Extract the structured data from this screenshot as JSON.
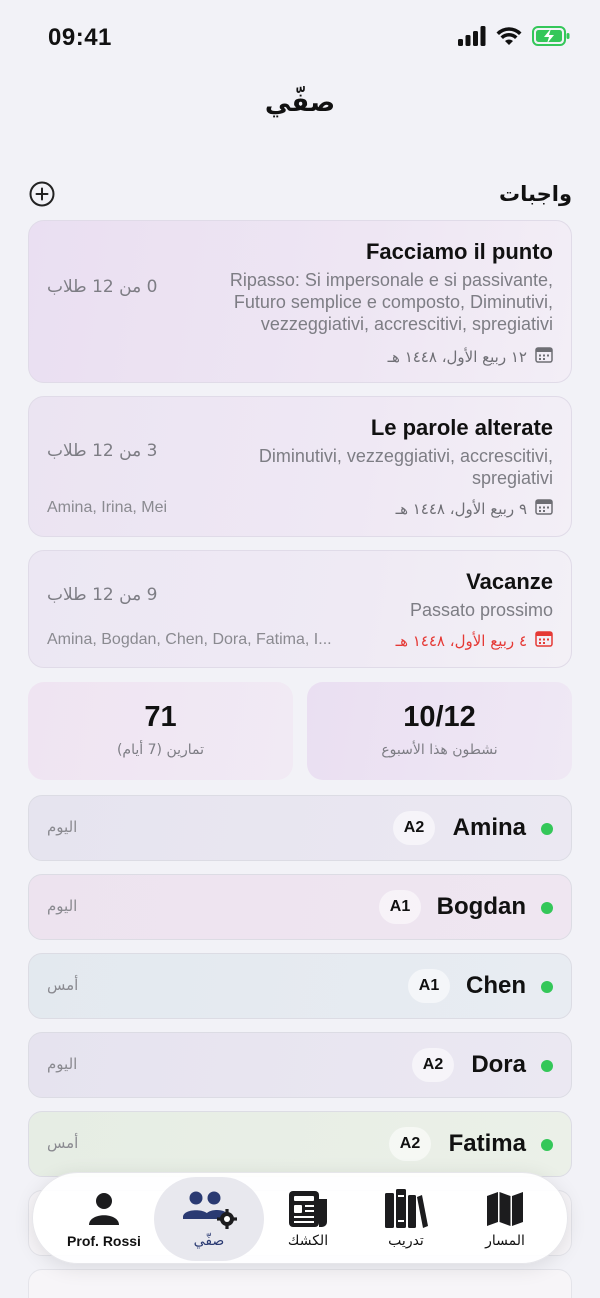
{
  "status": {
    "time": "09:41"
  },
  "page": {
    "title": "صفّي"
  },
  "assignments": {
    "title": "واجبات",
    "items": [
      {
        "title": "Facciamo il punto",
        "subtitle": "Ripasso: Si impersonale e si passivante, Futuro semplice e composto, Diminutivi, vezzeggiativi, accrescitivi, spregiativi",
        "date": "١٢ ربيع الأول، ١٤٤٨ هـ",
        "count": "0 من 12 طلاب",
        "names": "",
        "overdue": false
      },
      {
        "title": "Le parole alterate",
        "subtitle": "Diminutivi, vezzeggiativi, accrescitivi, spregiativi",
        "date": "٩ ربيع الأول، ١٤٤٨ هـ",
        "count": "3 من 12 طلاب",
        "names": "Amina, Irina, Mei",
        "overdue": false
      },
      {
        "title": "Vacanze",
        "subtitle": "Passato prossimo",
        "date": "٤ ربيع الأول، ١٤٤٨ هـ",
        "count": "9 من 12 طلاب",
        "names": "Amina, Bogdan, Chen, Dora, Fatima, I...",
        "overdue": true
      }
    ]
  },
  "stats": {
    "active": {
      "value": "10/12",
      "label": "نشطون هذا الأسبوع"
    },
    "exercises": {
      "value": "71",
      "label": "تمارين (7 أيام)"
    }
  },
  "students": [
    {
      "name": "Amina",
      "level": "A2",
      "last_seen": "اليوم"
    },
    {
      "name": "Bogdan",
      "level": "A1",
      "last_seen": "اليوم"
    },
    {
      "name": "Chen",
      "level": "A1",
      "last_seen": "أمس"
    },
    {
      "name": "Dora",
      "level": "A2",
      "last_seen": "اليوم"
    },
    {
      "name": "Fatima",
      "level": "A2",
      "last_seen": "أمس"
    }
  ],
  "tabs": {
    "path": "المسار",
    "practice": "تدريب",
    "kiosk": "الكشك",
    "class": "صفّي",
    "profile": "Prof. Rossi"
  },
  "colors": {
    "accent_green": "#34c759",
    "overdue_red": "#e53935"
  }
}
